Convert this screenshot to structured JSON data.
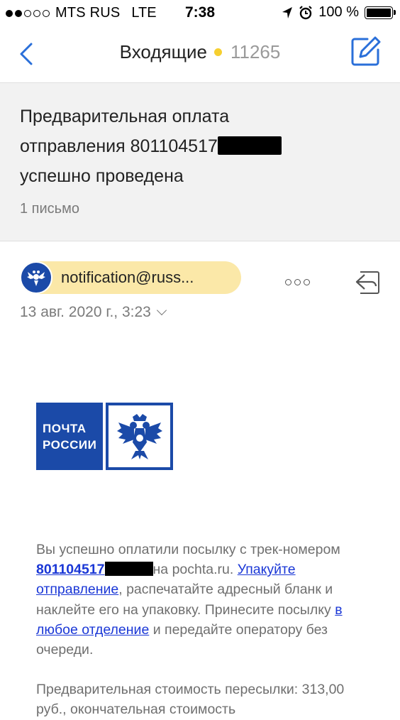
{
  "status_bar": {
    "signal_dots": [
      true,
      true,
      false,
      false,
      false
    ],
    "carrier": "MTS RUS",
    "network": "LTE",
    "time": "7:38",
    "battery_text": "100 %",
    "battery_level": 1.0
  },
  "nav": {
    "back_icon": "chevron-left-icon",
    "title": "Входящие",
    "unread_count": "11265",
    "compose_icon": "compose-icon",
    "accent_color": "#2a6fd9"
  },
  "thread": {
    "subject_line1": "Предварительная оплата",
    "subject_line2": "отправления 801104517",
    "subject_line3": "успешно проведена",
    "letters_count": "1 письмо"
  },
  "message": {
    "sender": "notification@russ...",
    "date": "13 авг. 2020 г., 3:23",
    "logo_text_line1": "ПОЧТА",
    "logo_text_line2": "РОССИИ",
    "body": {
      "p1_text1": "Вы успешно оплатили посылку с трек-номером ",
      "p1_track_link": "801104517",
      "p1_text2": "на pochta.ru.",
      "p1_link_pack": "Упакуйте отправление",
      "p1_text3": ", распечатайте адресный бланк и наклейте его на упаковку. Принесите посылку ",
      "p1_link_office": "в любое отделение",
      "p1_text4": " и передайте оператору без очереди.",
      "p2_text": "Предварительная стоимость пересылки: 313,00 руб., окончательная стоимость"
    }
  }
}
